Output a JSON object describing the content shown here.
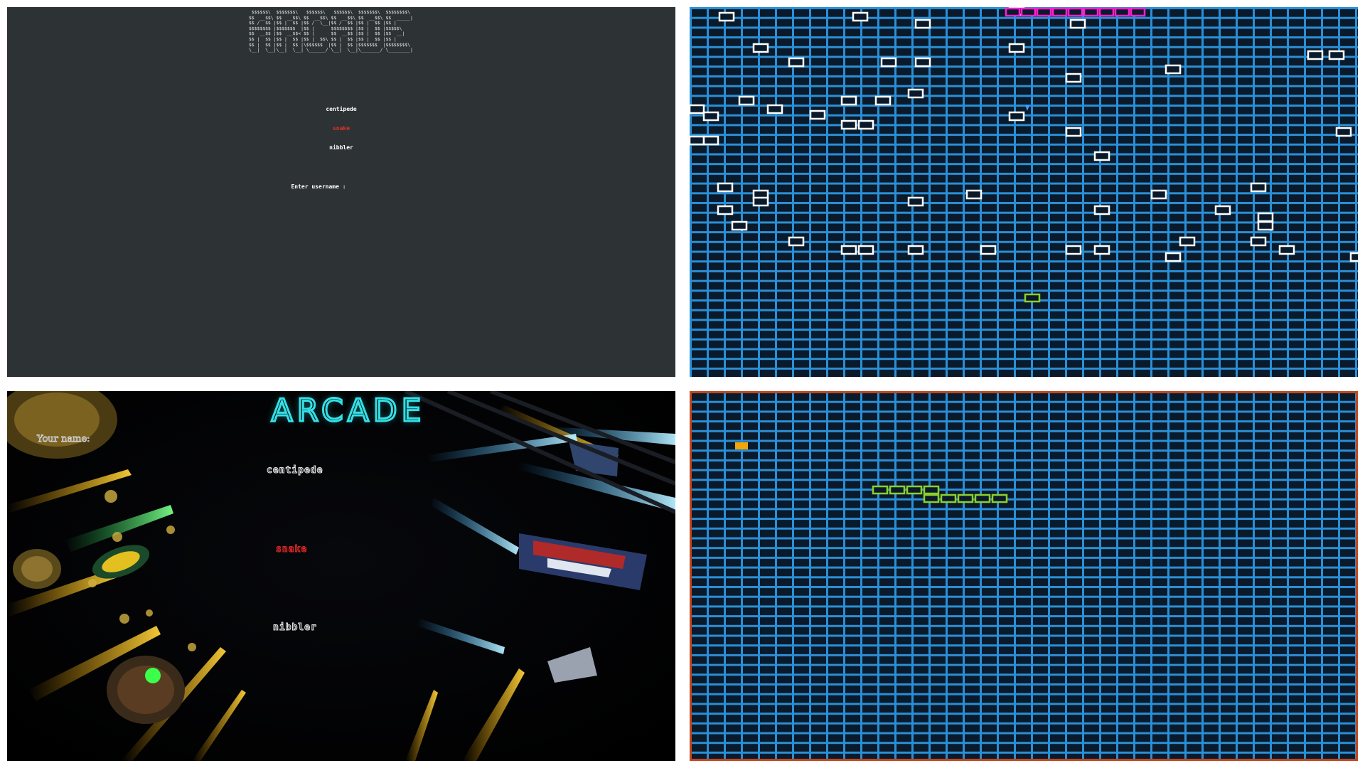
{
  "terminal": {
    "ascii_logo": " $$$$$$\\  $$$$$$$\\   $$$$$$\\   $$$$$$\\  $$$$$$$\\  $$$$$$$$\\\n$$  __$$\\ $$  __$$\\ $$  __$$\\ $$  __$$\\ $$  __$$\\ $$  _____|\n$$ /  $$ |$$ |  $$ |$$ /  \\__|$$ /  $$ |$$ |  $$ |$$ |\n$$$$$$$$ |$$$$$$$  |$$ |      $$$$$$$$ |$$ |  $$ |$$$$$\\\n$$  __$$ |$$  __$$< $$ |      $$  __$$ |$$ |  $$ |$$  __|\n$$ |  $$ |$$ |  $$ |$$ |  $$\\ $$ |  $$ |$$ |  $$ |$$ |\n$$ |  $$ |$$ |  $$ |\\$$$$$$  |$$ |  $$ |$$$$$$$  |$$$$$$$$\\\n\\__|  \\__|\\__|  \\__| \\______/ \\__|  \\__|\\_______/ \\________|",
    "menu": [
      "centipede",
      "snake",
      "nibbler"
    ],
    "selected": "snake",
    "prompt": "Enter username :",
    "colors": {
      "background": "#2d3235",
      "text": "#ffffff",
      "selected": "#e0302a"
    }
  },
  "graphical_menu": {
    "title": "ARCADE",
    "name_label": "Your name:",
    "menu": [
      "centipede",
      "snake",
      "nibbler"
    ],
    "selected": "snake",
    "colors": {
      "title": "#33e0e6",
      "text": "#eaeaea",
      "selected": "#e62a2a"
    }
  },
  "centipede_game": {
    "grid": {
      "cols": 39,
      "rows": 38
    },
    "colors": {
      "grid": "#2a8fd6",
      "mushroom": "#ffffff",
      "centipede": "#ff20d0",
      "player": "#8ccf2a",
      "bullet": "#3aa0ff"
    },
    "centipede_segments": 9,
    "mushroom_count": 56
  },
  "snake_game": {
    "grid": {
      "cols": 39,
      "rows": 38
    },
    "colors": {
      "grid": "#2a8fd6",
      "wall": "#c2461e",
      "snake": "#8ccf2a",
      "food": "#f2a60c"
    },
    "snake_length": 9
  }
}
